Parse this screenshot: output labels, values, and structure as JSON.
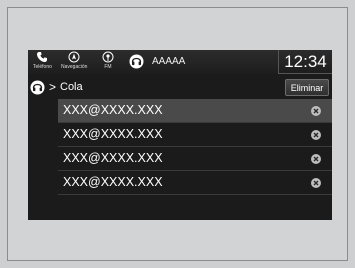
{
  "status_bar": {
    "phone_label": "Teléfono",
    "nav_label": "Navegación",
    "fm_label": "FM",
    "source_name": "AAAAA",
    "clock": "12:34"
  },
  "header": {
    "title": "Cola",
    "delete_label": "Eliminar"
  },
  "queue": {
    "items": [
      {
        "text": "XXX@XXXX.XXX",
        "selected": true
      },
      {
        "text": "XXX@XXXX.XXX",
        "selected": false
      },
      {
        "text": "XXX@XXXX.XXX",
        "selected": false
      },
      {
        "text": "XXX@XXXX.XXX",
        "selected": false
      }
    ]
  },
  "icons": {
    "phone": "phone-icon",
    "navigation": "navigation-icon",
    "fm": "fm-radio-icon",
    "source": "bluetooth-audio-icon",
    "back": "bluetooth-audio-icon",
    "remove": "remove-x-circle-icon"
  }
}
